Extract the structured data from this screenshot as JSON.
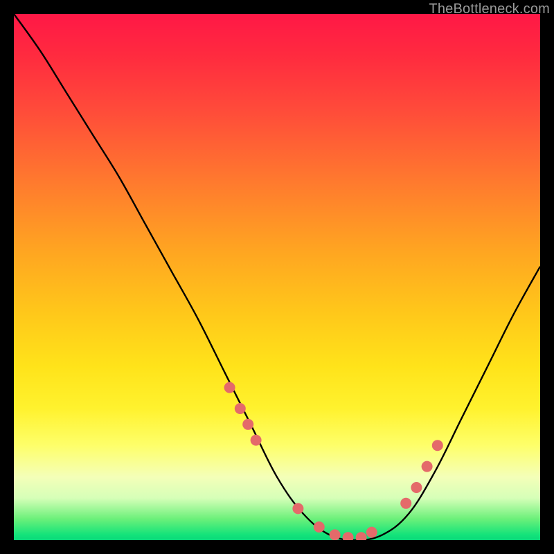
{
  "watermark": "TheBottleneck.com",
  "colors": {
    "curve_stroke": "#000000",
    "dot_fill": "#e46a6a",
    "bg_black": "#000000"
  },
  "chart_data": {
    "type": "line",
    "title": "",
    "xlabel": "",
    "ylabel": "",
    "xlim": [
      0,
      100
    ],
    "ylim": [
      0,
      100
    ],
    "grid": false,
    "legend": false,
    "series": [
      {
        "name": "curve",
        "x": [
          0,
          5,
          10,
          15,
          20,
          25,
          30,
          35,
          40,
          45,
          50,
          55,
          60,
          65,
          70,
          75,
          80,
          85,
          90,
          95,
          100
        ],
        "y": [
          100,
          93,
          85,
          77,
          69,
          60,
          51,
          42,
          32,
          22,
          12,
          5,
          1,
          0,
          1,
          5,
          13,
          23,
          33,
          43,
          52
        ]
      }
    ],
    "dots": {
      "name": "highlight-dots",
      "x": [
        41,
        43,
        44.5,
        46,
        54,
        58,
        61,
        63.5,
        66,
        68,
        74.5,
        76.5,
        78.5,
        80.5
      ],
      "y": [
        29,
        25,
        22,
        19,
        6,
        2.5,
        1,
        0.5,
        0.5,
        1.5,
        7,
        10,
        14,
        18
      ]
    }
  }
}
